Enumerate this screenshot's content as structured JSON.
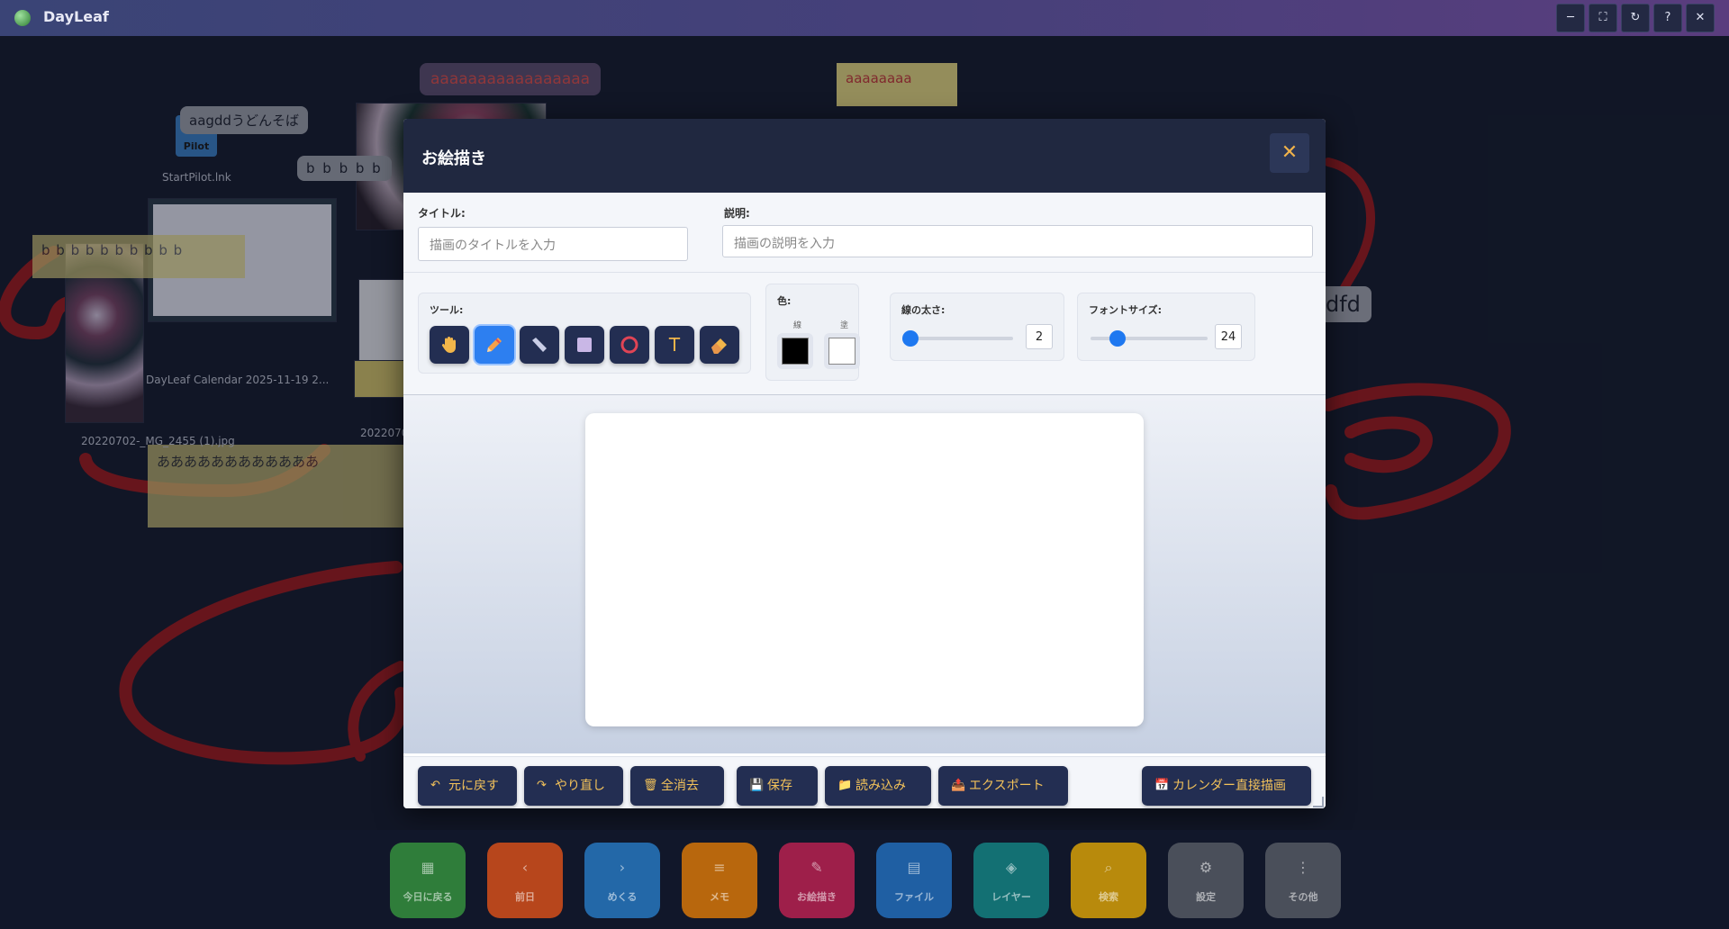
{
  "app": {
    "title": "DayLeaf"
  },
  "window_controls": [
    "─",
    "⛶",
    "↻",
    "?",
    "✕"
  ],
  "background": {
    "bubbles": [
      "aagddうどんそば",
      "b b b b b",
      "aaaaaaaaaaaaaaaaa",
      "dfd"
    ],
    "notes": [
      "aaaaaaaa",
      "b b b b b b b b b b",
      "b b b b b b b b b",
      "ああああああああああああ"
    ],
    "files": [
      "StartPilot.lnk",
      "DayLeaf Calendar 2025-11-19 2...",
      "20220702-_MG_2455 (1).jpg",
      "2022070"
    ],
    "icon_badge": "Pilot"
  },
  "modal": {
    "title": "お絵描き",
    "title_field": {
      "label": "タイトル:",
      "placeholder": "描画のタイトルを入力"
    },
    "desc_field": {
      "label": "説明:",
      "placeholder": "描画の説明を入力"
    },
    "tools": {
      "label": "ツール:",
      "items": [
        {
          "name": "hand",
          "active": false
        },
        {
          "name": "pen",
          "active": true
        },
        {
          "name": "line",
          "active": false
        },
        {
          "name": "rectangle",
          "active": false
        },
        {
          "name": "circle",
          "active": false
        },
        {
          "name": "text",
          "active": false,
          "glyph": "T"
        },
        {
          "name": "eraser",
          "active": false
        }
      ]
    },
    "colors": {
      "label": "色:",
      "stroke_label": "線",
      "fill_label": "塗",
      "stroke": "#000000",
      "fill": "#ffffff"
    },
    "line_width": {
      "label": "線の太さ:",
      "value": "2",
      "fraction": 0.05
    },
    "font_size": {
      "label": "フォントサイズ:",
      "value": "24",
      "fraction": 0.23
    },
    "actions": [
      {
        "icon": "↶",
        "label": "元に戻す"
      },
      {
        "icon": "↷",
        "label": "やり直し"
      },
      {
        "icon": "🗑",
        "label": "全消去"
      },
      {
        "icon": "💾",
        "label": "保存"
      },
      {
        "icon": "📁",
        "label": "読み込み"
      },
      {
        "icon": "📤",
        "label": "エクスポート"
      },
      {
        "icon": "📅",
        "label": "カレンダー直接描画"
      }
    ]
  },
  "dock": [
    {
      "label": "今日に戻る",
      "icon": "▦",
      "color": "#2f7d3a"
    },
    {
      "label": "前日",
      "icon": "‹",
      "color": "#b7461c"
    },
    {
      "label": "めくる",
      "icon": "›",
      "color": "#2368a8"
    },
    {
      "label": "メモ",
      "icon": "≡",
      "color": "#b8670d"
    },
    {
      "label": "お絵描き",
      "icon": "✎",
      "color": "#9e1f4a"
    },
    {
      "label": "ファイル",
      "icon": "▤",
      "color": "#1f5fa3"
    },
    {
      "label": "レイヤー",
      "icon": "◈",
      "color": "#137073"
    },
    {
      "label": "検索",
      "icon": "⌕",
      "color": "#b88a0c"
    },
    {
      "label": "設定",
      "icon": "⚙",
      "color": "#4a4f5a"
    },
    {
      "label": "その他",
      "icon": "⋮",
      "color": "#4a4f5a"
    }
  ]
}
